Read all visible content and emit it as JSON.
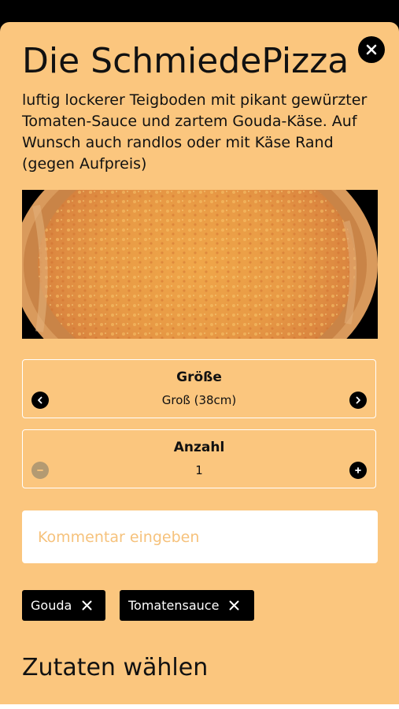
{
  "product": {
    "title": "Die SchmiedePizza",
    "description": "luftig lockerer Teigboden mit pikant gewürzter Tomaten-Sauce und zartem Gouda-Käse. Auf Wunsch auch randlos oder mit Käse Rand (gegen Aufpreis)"
  },
  "size": {
    "label": "Größe",
    "value": "Groß (38cm)"
  },
  "quantity": {
    "label": "Anzahl",
    "value": "1"
  },
  "comment": {
    "placeholder": "Kommentar eingeben",
    "value": ""
  },
  "selected_ingredients": [
    {
      "label": "Gouda"
    },
    {
      "label": "Tomatensauce"
    }
  ],
  "ingredients_heading": "Zutaten wählen",
  "icons": {
    "close": "close-icon",
    "prev": "chevron-left-icon",
    "next": "chevron-right-icon",
    "minus": "minus-icon",
    "plus": "plus-icon",
    "remove": "remove-x-icon"
  },
  "colors": {
    "sheet_background": "#fbc67e",
    "placeholder_text": "#f6c27c",
    "disabled_button": "#b39a72",
    "dark": "#000000"
  }
}
